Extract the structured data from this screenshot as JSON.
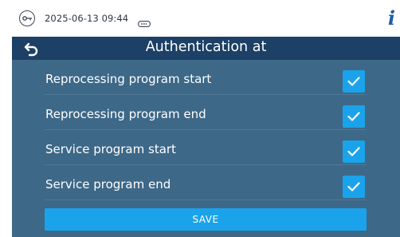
{
  "status_bar": {
    "datetime": "2025-06-13 09:44",
    "icons": [
      "key-icon",
      "card-icon",
      "info-icon"
    ],
    "info_label": "i"
  },
  "header": {
    "title": "Authentication at",
    "back_icon": "back-arrow-icon"
  },
  "options": [
    {
      "label": "Reprocessing program start",
      "checked": true
    },
    {
      "label": "Reprocessing program end",
      "checked": true
    },
    {
      "label": "Service program start",
      "checked": true
    },
    {
      "label": "Service program end",
      "checked": true
    }
  ],
  "save_label": "SAVE",
  "colors": {
    "title_bar": "#1c4066",
    "content_bg": "#3d6888",
    "accent": "#1aa3ea",
    "info_icon": "#1f5fa8"
  }
}
